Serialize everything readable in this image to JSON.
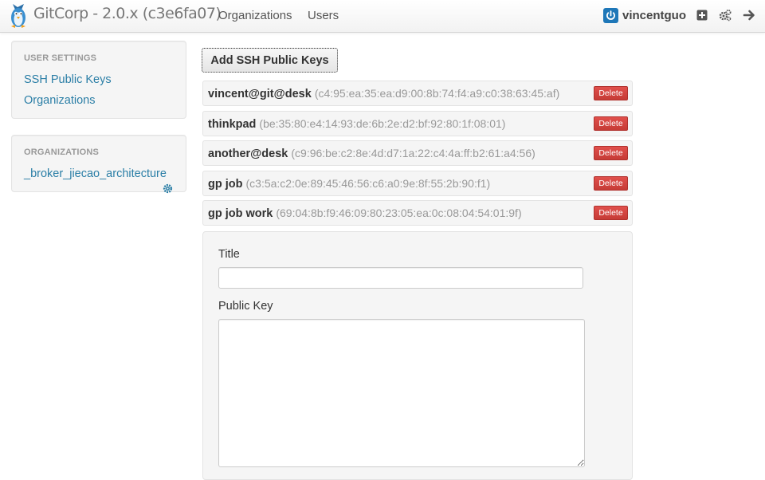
{
  "navbar": {
    "brand": "GitCorp - 2.0.x (c3e6fa07)",
    "links": [
      "Organizations",
      "Users"
    ],
    "username": "vincentguo",
    "icons": [
      "plus-square-icon",
      "cogs-icon",
      "arrow-right-icon"
    ]
  },
  "sidebar": {
    "user_settings": {
      "header": "USER SETTINGS",
      "links": [
        "SSH Public Keys",
        "Organizations"
      ]
    },
    "organizations": {
      "header": "ORGANIZATIONS",
      "items": [
        "_broker_jiecao_architecture"
      ]
    }
  },
  "main": {
    "add_button": "Add SSH Public Keys",
    "delete_label": "Delete",
    "keys": [
      {
        "title": "vincent@git@desk",
        "fingerprint": "(c4:95:ea:35:ea:d9:00:8b:74:f4:a9:c0:38:63:45:af)"
      },
      {
        "title": "thinkpad",
        "fingerprint": "(be:35:80:e4:14:93:de:6b:2e:d2:bf:92:80:1f:08:01)"
      },
      {
        "title": "another@desk",
        "fingerprint": "(c9:96:be:c2:8e:4d:d7:1a:22:c4:4a:ff:b2:61:a4:56)"
      },
      {
        "title": "gp job",
        "fingerprint": "(c3:5a:c2:0e:89:45:46:56:c6:a0:9e:8f:55:2b:90:f1)"
      },
      {
        "title": "gp job work",
        "fingerprint": "(69:04:8b:f9:46:09:80:23:05:ea:0c:08:04:54:01:9f)"
      }
    ],
    "form": {
      "title_label": "Title",
      "title_value": "",
      "key_label": "Public Key",
      "key_value": ""
    }
  },
  "colors": {
    "link": "#2a7ea6",
    "danger": "#da4f49",
    "user_icon": "#1e77b8"
  }
}
